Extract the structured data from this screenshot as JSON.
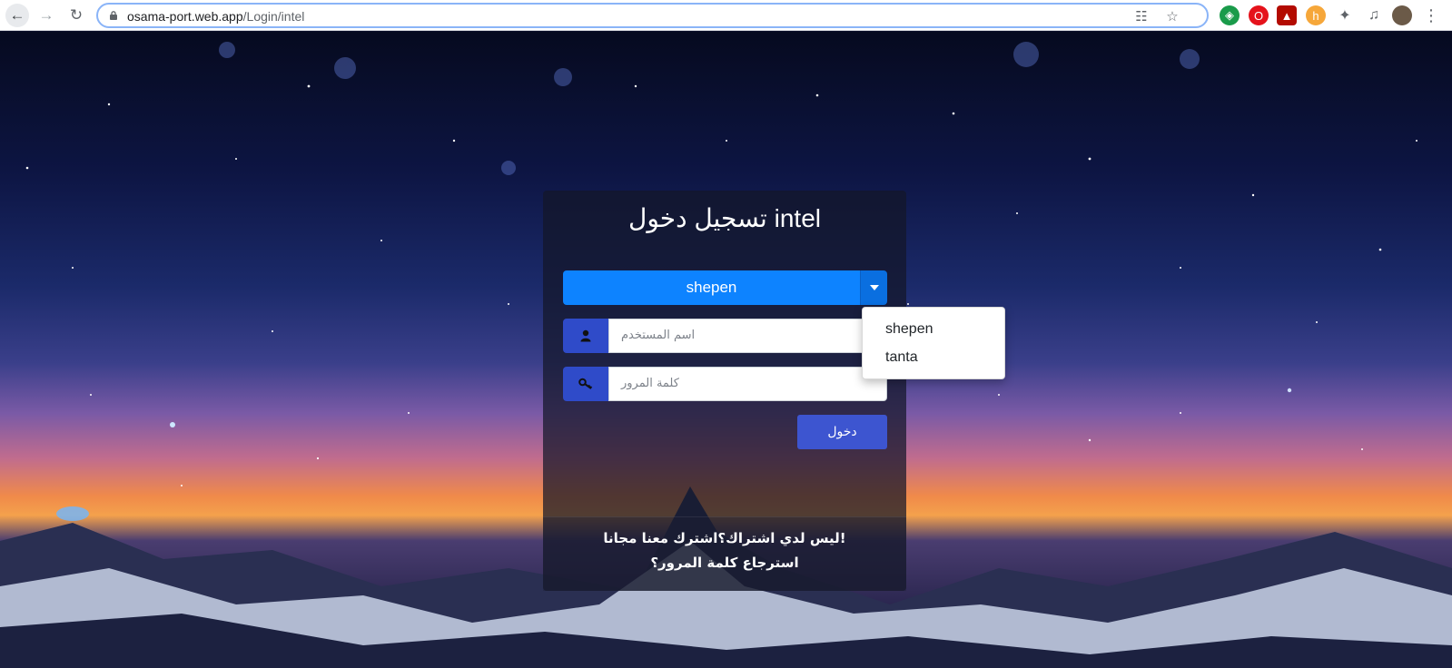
{
  "browser": {
    "url_host": "osama-port.web.app",
    "url_path": "/Login/intel",
    "icons": [
      "back-icon",
      "forward-icon",
      "reload-icon",
      "lock-icon",
      "translate-icon",
      "star-icon"
    ],
    "extensions": [
      "shield-extension-icon",
      "opera-extension-icon",
      "pdf-extension-icon",
      "honey-extension-icon",
      "puzzle-icon",
      "media-icon",
      "profile-avatar",
      "more-icon"
    ]
  },
  "login": {
    "title": "تسجيل دخول intel",
    "selected_branch": "shepen",
    "username_placeholder": "اسم المستخدم",
    "password_placeholder": "كلمة المرور",
    "submit_label": "دخول",
    "signup_text": "ليس لدي اشتراك؟اشترك معنا مجانا!",
    "forgot_text": "استرجاع كلمة المرور؟"
  },
  "dropdown": {
    "options": [
      "shepen",
      "tanta"
    ]
  },
  "colors": {
    "primary": "#0d83ff",
    "icon_box": "#2f4bc9",
    "submit": "#3d55d0"
  }
}
